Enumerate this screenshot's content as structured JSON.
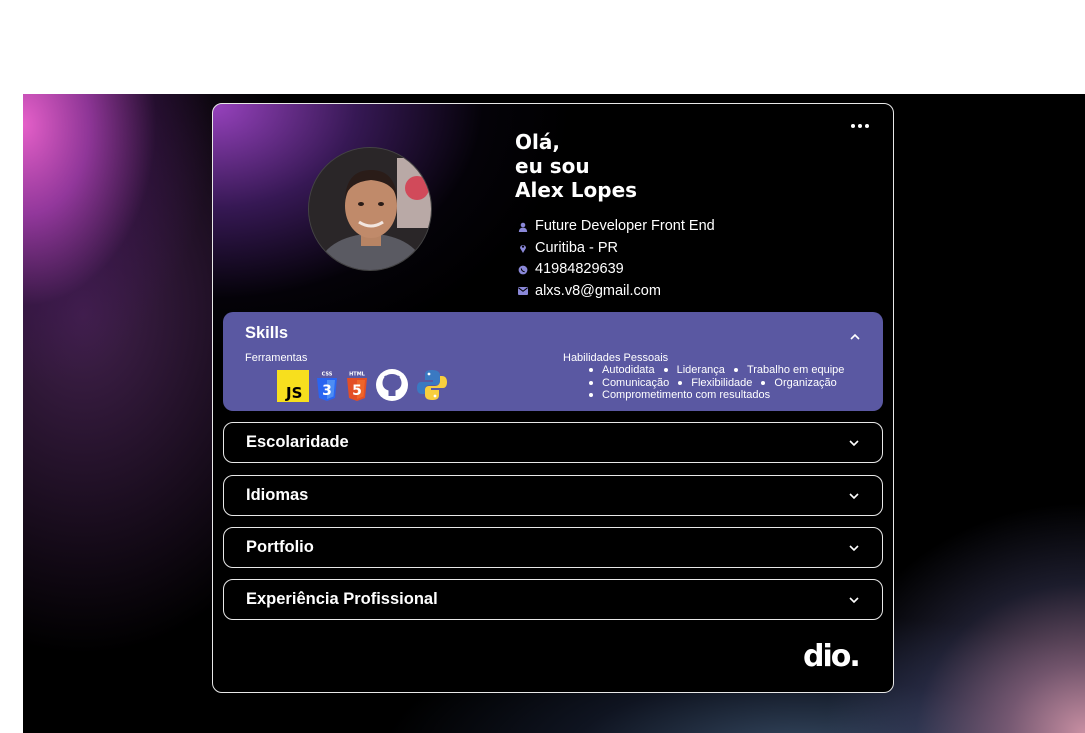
{
  "profile": {
    "greeting_line1": "Olá,",
    "greeting_line2": "eu sou",
    "name": "Alex Lopes",
    "role": "Future Developer Front End",
    "location": "Curitiba - PR",
    "phone": "41984829639",
    "email": "alxs.v8@gmail.com"
  },
  "icons": {
    "role": "person-icon",
    "location": "map-pin-icon",
    "phone": "whatsapp-icon",
    "email": "mail-icon",
    "more": "more-horizontal-icon"
  },
  "skills": {
    "title": "Skills",
    "tools_label": "Ferramentas",
    "tools": [
      "JS",
      "CSS",
      "HTML",
      "GitHub",
      "Python"
    ],
    "css_badge": "CSS",
    "html_badge": "HTML",
    "css_digit": "3",
    "html_digit": "5",
    "personal_label": "Habilidades Pessoais",
    "personal": [
      [
        "Autodidata",
        "Liderança",
        "Trabalho em equipe"
      ],
      [
        "Comunicação",
        "Flexibilidade",
        "Organização"
      ],
      [
        "Comprometimento com resultados"
      ]
    ]
  },
  "sections": [
    "Escolaridade",
    "Idiomas",
    "Portfolio",
    "Experiência Profissional"
  ],
  "brand": {
    "logo_text": "dio."
  },
  "colors": {
    "skills_bg": "#5a58a2",
    "icon_accent": "#8a88d8",
    "js_yellow": "#f7df1e",
    "css_blue": "#2965f1",
    "html_orange": "#e34f26"
  }
}
